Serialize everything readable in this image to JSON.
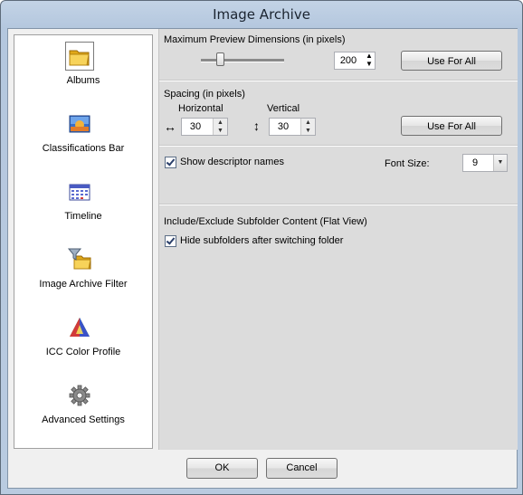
{
  "window": {
    "title": "Image Archive"
  },
  "sidebar": {
    "items": [
      {
        "label": "Albums",
        "icon": "albums-folder-icon",
        "selected": true
      },
      {
        "label": "Classifications Bar",
        "icon": "classifications-bar-icon"
      },
      {
        "label": "Timeline",
        "icon": "timeline-calendar-icon"
      },
      {
        "label": "Image Archive Filter",
        "icon": "filter-icon"
      },
      {
        "label": "ICC Color Profile",
        "icon": "color-profile-icon"
      },
      {
        "label": "Advanced Settings",
        "icon": "gear-icon"
      }
    ]
  },
  "panel": {
    "preview": {
      "title": "Maximum Preview Dimensions (in pixels)",
      "value": "200",
      "slider_fraction": 0.2,
      "button": "Use For All"
    },
    "spacing": {
      "title": "Spacing (in pixels)",
      "horizontal_label": "Horizontal",
      "horizontal_value": "30",
      "vertical_label": "Vertical",
      "vertical_value": "30",
      "button": "Use For All"
    },
    "descriptor": {
      "checkbox_label": "Show descriptor names",
      "checked": true,
      "font_size_label": "Font Size:",
      "font_size_value": "9"
    },
    "subfolder": {
      "title": "Include/Exclude Subfolder Content (Flat View)",
      "checkbox_label": "Hide subfolders after switching folder",
      "checked": true
    }
  },
  "footer": {
    "ok": "OK",
    "cancel": "Cancel"
  }
}
